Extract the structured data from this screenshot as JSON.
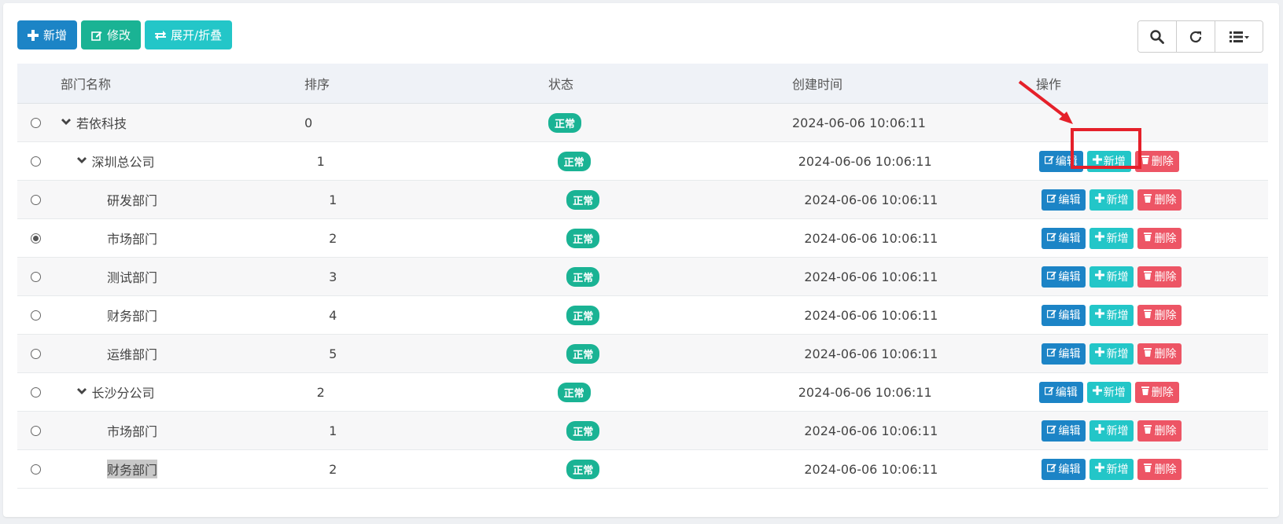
{
  "toolbar": {
    "add_label": "新增",
    "edit_label": "修改",
    "toggle_label": "展开/折叠"
  },
  "table": {
    "headers": {
      "name": "部门名称",
      "order": "排序",
      "status": "状态",
      "time": "创建时间",
      "ops": "操作"
    },
    "rows": [
      {
        "name": "若依科技",
        "order": "0",
        "status": "正常",
        "time": "2024-06-06 10:06:11",
        "level": 0,
        "expandable": true,
        "selected": false,
        "actions": false
      },
      {
        "name": "深圳总公司",
        "order": "1",
        "status": "正常",
        "time": "2024-06-06 10:06:11",
        "level": 1,
        "expandable": true,
        "selected": false,
        "actions": true
      },
      {
        "name": "研发部门",
        "order": "1",
        "status": "正常",
        "time": "2024-06-06 10:06:11",
        "level": 2,
        "expandable": false,
        "selected": false,
        "actions": true
      },
      {
        "name": "市场部门",
        "order": "2",
        "status": "正常",
        "time": "2024-06-06 10:06:11",
        "level": 2,
        "expandable": false,
        "selected": true,
        "actions": true
      },
      {
        "name": "测试部门",
        "order": "3",
        "status": "正常",
        "time": "2024-06-06 10:06:11",
        "level": 2,
        "expandable": false,
        "selected": false,
        "actions": true
      },
      {
        "name": "财务部门",
        "order": "4",
        "status": "正常",
        "time": "2024-06-06 10:06:11",
        "level": 2,
        "expandable": false,
        "selected": false,
        "actions": true
      },
      {
        "name": "运维部门",
        "order": "5",
        "status": "正常",
        "time": "2024-06-06 10:06:11",
        "level": 2,
        "expandable": false,
        "selected": false,
        "actions": true
      },
      {
        "name": "长沙分公司",
        "order": "2",
        "status": "正常",
        "time": "2024-06-06 10:06:11",
        "level": 1,
        "expandable": true,
        "selected": false,
        "actions": true
      },
      {
        "name": "市场部门",
        "order": "1",
        "status": "正常",
        "time": "2024-06-06 10:06:11",
        "level": 2,
        "expandable": false,
        "selected": false,
        "actions": true
      },
      {
        "name": "财务部门",
        "order": "2",
        "status": "正常",
        "time": "2024-06-06 10:06:11",
        "level": 2,
        "expandable": false,
        "selected": false,
        "actions": true,
        "highlight": true
      }
    ],
    "action_labels": {
      "edit": "编辑",
      "add": "新增",
      "delete": "删除"
    }
  },
  "icons": {
    "search": "search-icon",
    "refresh": "refresh-icon",
    "columns": "list-columns-icon"
  },
  "colors": {
    "primary": "#1c84c6",
    "success": "#1ab394",
    "info": "#23c6c8",
    "danger": "#ed5565",
    "annotation": "#e5202a"
  }
}
